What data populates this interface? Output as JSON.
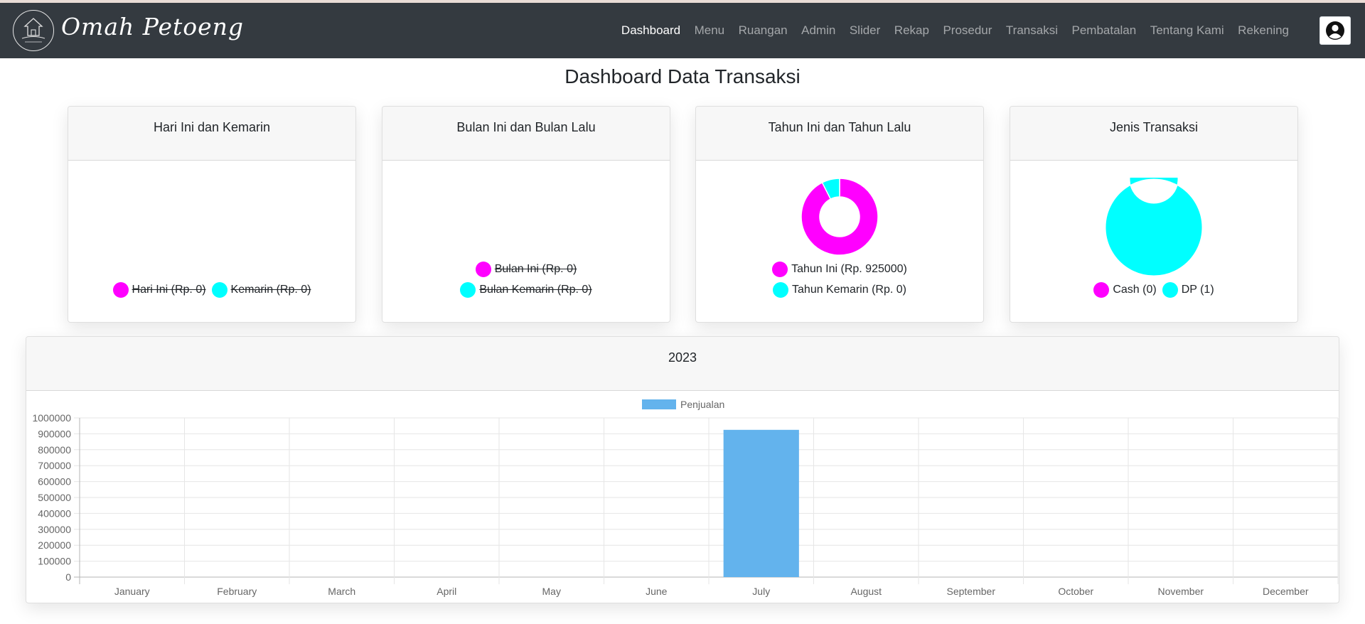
{
  "navbar": {
    "brand": "Omah Petoeng",
    "links": [
      "Dashboard",
      "Menu",
      "Ruangan",
      "Admin",
      "Slider",
      "Rekap",
      "Prosedur",
      "Transaksi",
      "Pembatalan",
      "Tentang Kami",
      "Rekening"
    ],
    "active": "Dashboard",
    "user_icon": "user-circle-icon"
  },
  "page": {
    "title": "Dashboard Data Transaksi"
  },
  "colors": {
    "magenta": "#ff00ff",
    "cyan": "#00ffff",
    "bar": "#63b3ed",
    "navbar": "#343a40"
  },
  "cards": [
    {
      "title": "Hari Ini dan Kemarin",
      "legend": [
        "Hari Ini (Rp. 0)",
        "Kemarin (Rp. 0)"
      ]
    },
    {
      "title": "Bulan Ini dan Bulan Lalu",
      "legend": [
        "Bulan Ini (Rp. 0)",
        "Bulan Kemarin (Rp. 0)"
      ]
    },
    {
      "title": "Tahun Ini dan Tahun Lalu",
      "legend": [
        "Tahun Ini (Rp. 925000)",
        "Tahun Kemarin (Rp. 0)"
      ]
    },
    {
      "title": "Jenis Transaksi",
      "legend": [
        "Cash (0)",
        "DP (1)"
      ]
    }
  ],
  "chart_data": [
    {
      "type": "pie",
      "title": "Hari Ini dan Kemarin",
      "categories": [
        "Hari Ini",
        "Kemarin"
      ],
      "values": [
        0,
        0
      ]
    },
    {
      "type": "pie",
      "title": "Bulan Ini dan Bulan Lalu",
      "categories": [
        "Bulan Ini",
        "Bulan Kemarin"
      ],
      "values": [
        0,
        0
      ]
    },
    {
      "type": "pie",
      "title": "Tahun Ini dan Tahun Lalu",
      "categories": [
        "Tahun Ini",
        "Tahun Kemarin"
      ],
      "values": [
        925000,
        75000
      ]
    },
    {
      "type": "pie",
      "title": "Jenis Transaksi",
      "categories": [
        "Cash",
        "DP"
      ],
      "values": [
        0,
        1
      ]
    },
    {
      "type": "bar",
      "title": "2023",
      "categories": [
        "January",
        "February",
        "March",
        "April",
        "May",
        "June",
        "July",
        "August",
        "September",
        "October",
        "November",
        "December"
      ],
      "series": [
        {
          "name": "Penjualan",
          "values": [
            0,
            0,
            0,
            0,
            0,
            0,
            925000,
            0,
            0,
            0,
            0,
            0
          ]
        }
      ],
      "ylim": [
        0,
        1000000
      ],
      "yticks": [
        "0",
        "100000",
        "200000",
        "300000",
        "400000",
        "500000",
        "600000",
        "700000",
        "800000",
        "900000",
        "1000000"
      ],
      "grid": true,
      "legend": "top-center"
    }
  ]
}
